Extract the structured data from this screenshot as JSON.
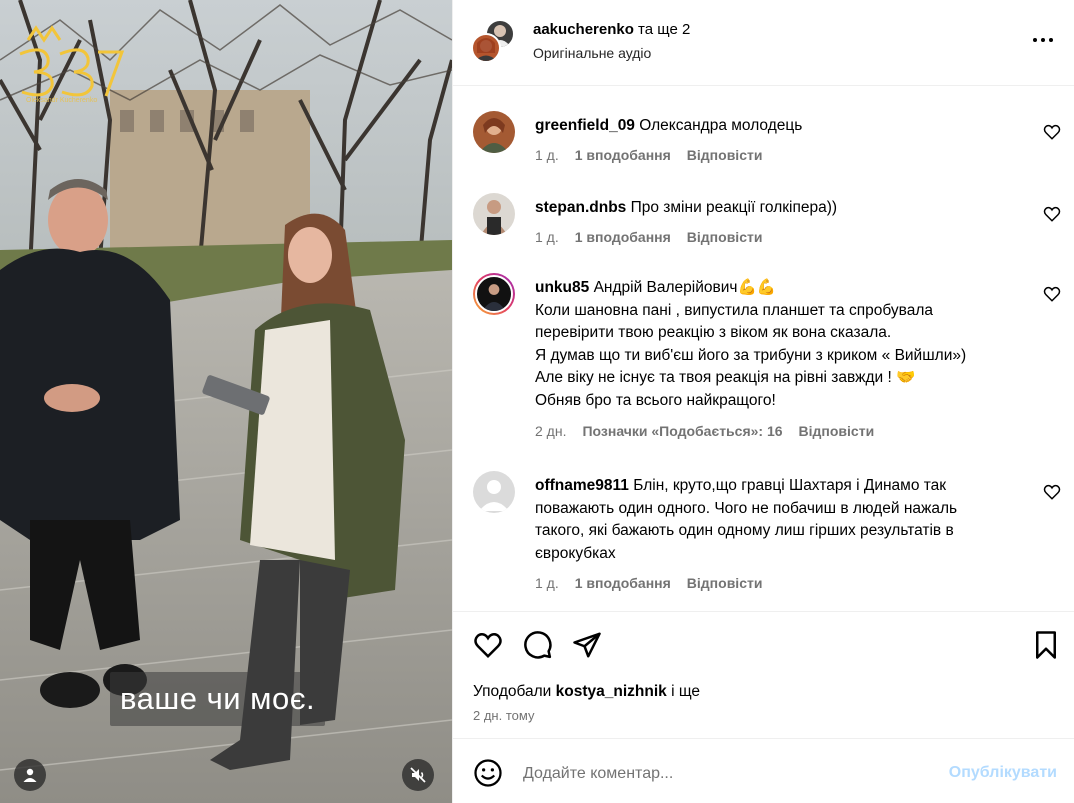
{
  "video": {
    "caption": "ваше чи моє."
  },
  "header": {
    "username": "aakucherenko",
    "and_more": " та ще 2",
    "audio": "Оригінальне аудіо"
  },
  "comments": [
    {
      "username": "greenfield_09",
      "text": "Олександра молодець",
      "time": "1 д.",
      "likes": "1 вподобання",
      "reply": "Відповісти"
    },
    {
      "username": "stepan.dnbs",
      "text": "Про зміни реакції голкіпера))",
      "time": "1 д.",
      "likes": "1 вподобання",
      "reply": "Відповісти"
    },
    {
      "username": "unku85",
      "text_lines": [
        "Андрій Валерійович💪💪",
        "Коли шановна пані , випустила планшет та спробувала",
        "перевірити твою реакцію з віком як вона сказала.",
        "Я думав що ти виб'єш його за трибуни з криком « Вийшли»)",
        "Але віку не існує та твоя реакція на рівні завжди ! 🤝",
        "Обняв бро та всього найкращого!"
      ],
      "time": "2 дн.",
      "likes": "Позначки «Подобається»: 16",
      "reply": "Відповісти"
    },
    {
      "username": "offname9811",
      "text_lines": [
        "Блін, круто,що гравці Шахтаря і Динамо так",
        "поважають один одного. Чого не побачиш в людей нажаль",
        "такого, які бажають один одному лиш гірших результатів в",
        "єврокубках"
      ],
      "time": "1 д.",
      "likes": "1 вподобання",
      "reply": "Відповісти"
    }
  ],
  "actions": {
    "liked_by_prefix": "Уподобали ",
    "liked_by_user": "kostya_nizhnik",
    "liked_by_suffix": " і ще",
    "posted_time": "2 дн. тому"
  },
  "add_comment": {
    "placeholder": "Додайте коментар...",
    "publish": "Опублікувати"
  },
  "colors": {
    "muted_text": "#737373",
    "publish_disabled": "#b3dbff",
    "divider": "#efefef"
  }
}
